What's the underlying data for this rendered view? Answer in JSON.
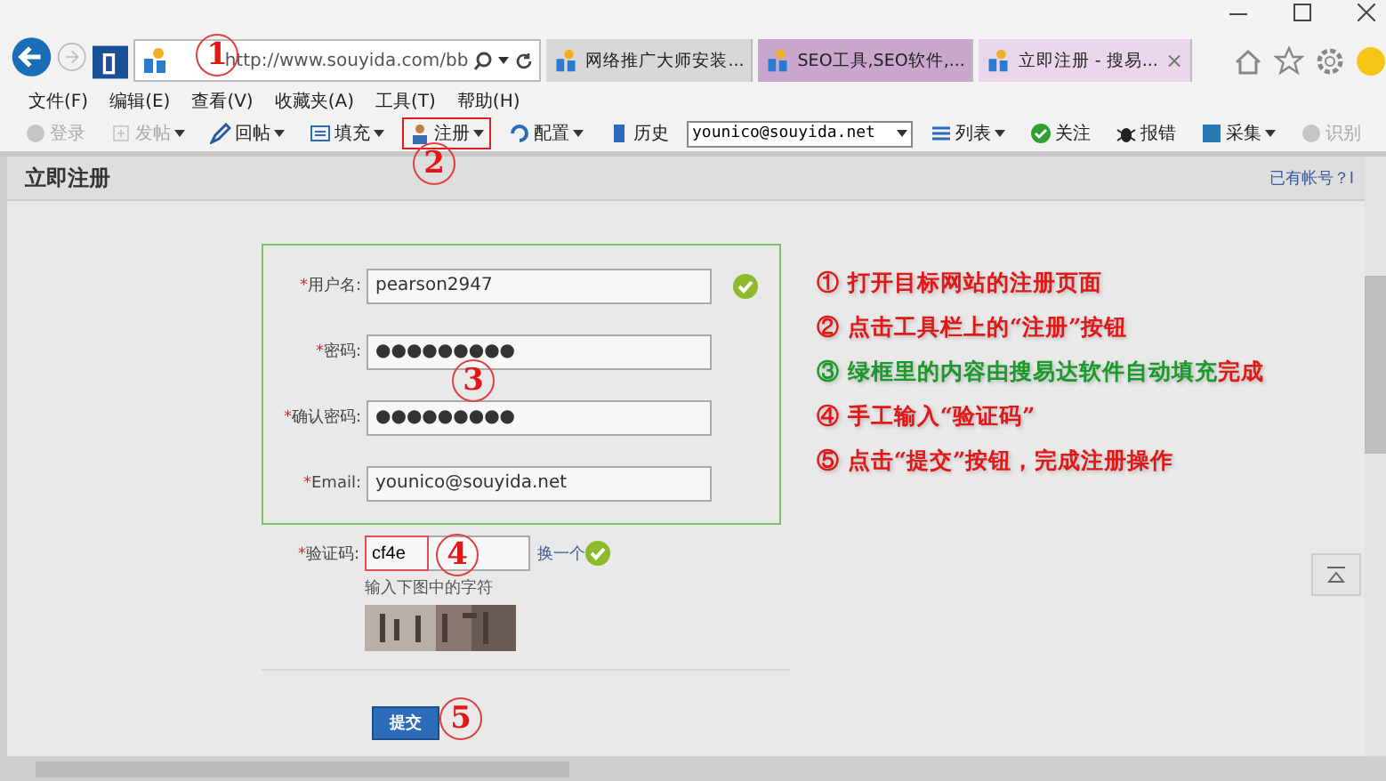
{
  "address_bar": {
    "url": "http://www.souyida.com/bb"
  },
  "tabs": [
    {
      "label": "网络推广大师安装...",
      "selected": false,
      "color": "#d8d8d8"
    },
    {
      "label": "SEO工具,SEO软件,...",
      "selected": false,
      "color": "#c9a6cc"
    },
    {
      "label": "立即注册 - 搜易...",
      "selected": true,
      "color": "#ead6ea"
    }
  ],
  "tab_close": "×",
  "menu": [
    "文件(F)",
    "编辑(E)",
    "查看(V)",
    "收藏夹(A)",
    "工具(T)",
    "帮助(H)"
  ],
  "toolbar_left": [
    {
      "label": "登录",
      "disabled": true,
      "dropdown": false,
      "highlighted": false
    },
    {
      "label": "发帖",
      "disabled": true,
      "dropdown": true,
      "highlighted": false
    },
    {
      "label": "回帖",
      "disabled": false,
      "dropdown": true,
      "highlighted": false
    },
    {
      "label": "填充",
      "disabled": false,
      "dropdown": true,
      "highlighted": false
    },
    {
      "label": "注册",
      "disabled": false,
      "dropdown": true,
      "highlighted": true
    },
    {
      "label": "配置",
      "disabled": false,
      "dropdown": true,
      "highlighted": false
    },
    {
      "label": "历史",
      "disabled": false,
      "dropdown": false,
      "highlighted": false
    }
  ],
  "account_select": {
    "value": "younico@souyida.net"
  },
  "toolbar_right": [
    {
      "label": "列表",
      "disabled": false,
      "dropdown": true,
      "highlighted": false
    },
    {
      "label": "关注",
      "disabled": false,
      "dropdown": false,
      "highlighted": false
    },
    {
      "label": "报错",
      "disabled": false,
      "dropdown": false,
      "highlighted": false
    },
    {
      "label": "采集",
      "disabled": false,
      "dropdown": true,
      "highlighted": false
    },
    {
      "label": "识别",
      "disabled": true,
      "dropdown": false,
      "highlighted": false
    }
  ],
  "page": {
    "title": "立即注册",
    "login_link": "已有帐号？I"
  },
  "form": {
    "required_mark": "*",
    "fields": [
      {
        "label": "用户名:",
        "value": "pearson2947",
        "required": true,
        "valid": true
      },
      {
        "label": "密码:",
        "value": "●●●●●●●●●",
        "required": true,
        "valid": false
      },
      {
        "label": "确认密码:",
        "value": "●●●●●●●●●",
        "required": true,
        "valid": false
      },
      {
        "label": "Email:",
        "value": "younico@souyida.net",
        "required": true,
        "valid": false
      }
    ],
    "captcha": {
      "label": "验证码:",
      "value": "cf4e",
      "required": true,
      "refresh_link": "换一个",
      "valid": true,
      "hint": "输入下图中的字符"
    },
    "submit": "提交"
  },
  "callouts": [
    "1",
    "2",
    "3",
    "4",
    "5"
  ],
  "instructions": [
    {
      "number": "①",
      "parts": [
        {
          "text": "打开目标网站的注册页面",
          "color": "#e01818"
        }
      ]
    },
    {
      "number": "②",
      "parts": [
        {
          "text": "点击工具栏上的“注册”按钮",
          "color": "#e01818"
        }
      ]
    },
    {
      "number": "③",
      "parts": [
        {
          "text": "绿框里的内容由搜易达软件自动填充",
          "color": "#1a9a2a"
        },
        {
          "text": "完成",
          "color": "#e01818"
        }
      ]
    },
    {
      "number": "④",
      "parts": [
        {
          "text": "手工输入“验证码”",
          "color": "#e01818"
        }
      ]
    },
    {
      "number": "⑤",
      "parts": [
        {
          "text": "点击“提交”按钮，完成注册操作",
          "color": "#e01818"
        }
      ]
    }
  ]
}
